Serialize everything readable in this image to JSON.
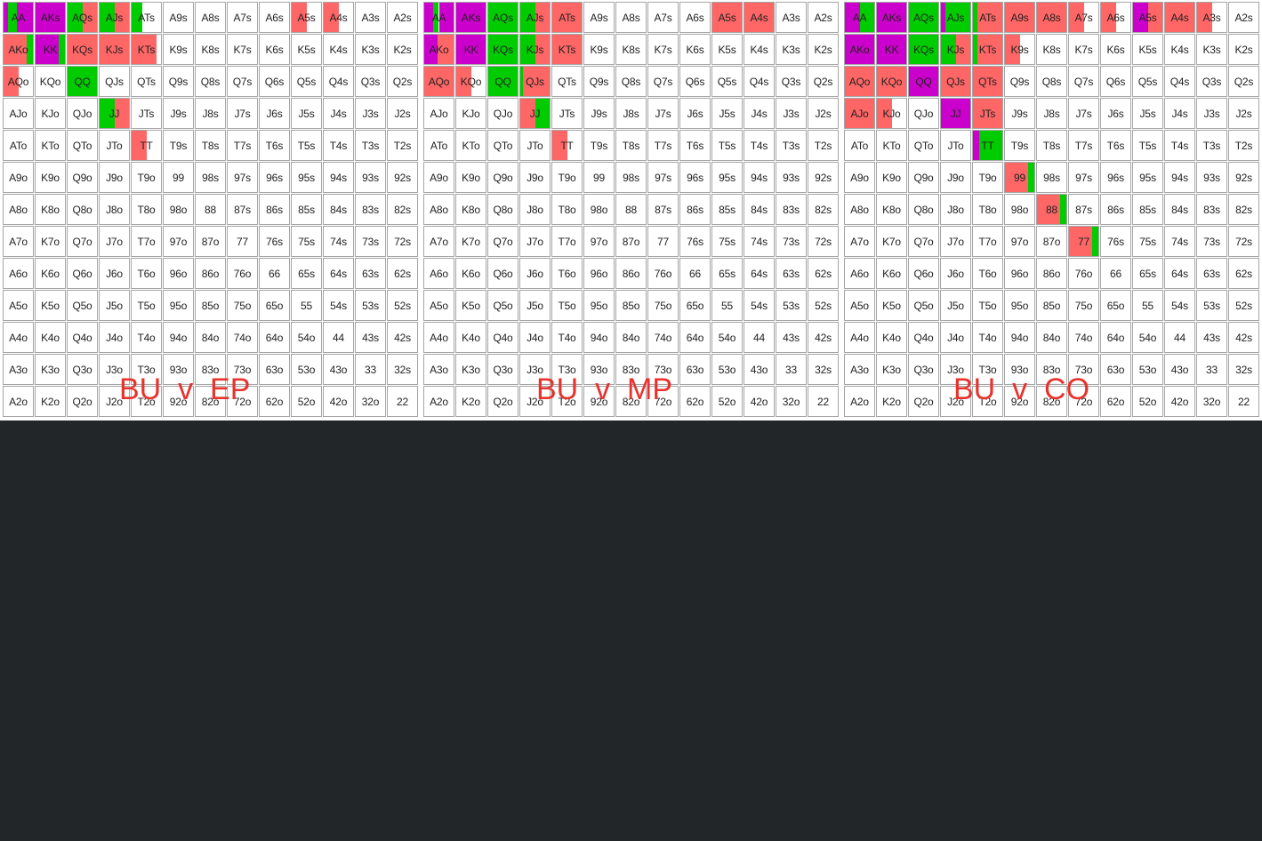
{
  "colors": {
    "raise": "#cc00cc",
    "call": "#00cc00",
    "threebet": "#ff6666",
    "empty": "#ffffff",
    "background": "#232629",
    "title": "#e8322d"
  },
  "ranks": [
    "A",
    "K",
    "Q",
    "J",
    "T",
    "9",
    "8",
    "7",
    "6",
    "5",
    "4",
    "3",
    "2"
  ],
  "charts": [
    {
      "title": "BU  v  EP",
      "segments": {
        "AA": [
          [
            "raise",
            0.15
          ],
          [
            "call",
            0.3
          ],
          [
            "raise",
            0.55
          ]
        ],
        "AKs": [
          [
            "raise",
            1.0
          ]
        ],
        "AQs": [
          [
            "call",
            0.5
          ],
          [
            "threebet",
            0.5
          ]
        ],
        "AJs": [
          [
            "call",
            0.5
          ],
          [
            "threebet",
            0.5
          ]
        ],
        "ATs": [
          [
            "call",
            0.35
          ],
          [
            "empty",
            0.65
          ]
        ],
        "A5s": [
          [
            "threebet",
            0.5
          ],
          [
            "empty",
            0.5
          ]
        ],
        "A4s": [
          [
            "threebet",
            0.5
          ],
          [
            "empty",
            0.5
          ]
        ],
        "AKo": [
          [
            "threebet",
            0.8
          ],
          [
            "call",
            0.2
          ]
        ],
        "KK": [
          [
            "raise",
            0.8
          ],
          [
            "call",
            0.2
          ]
        ],
        "KQs": [
          [
            "threebet",
            1.0
          ]
        ],
        "KJs": [
          [
            "threebet",
            1.0
          ]
        ],
        "KTs": [
          [
            "threebet",
            0.85
          ],
          [
            "empty",
            0.15
          ]
        ],
        "AQo": [
          [
            "threebet",
            0.5
          ],
          [
            "empty",
            0.5
          ]
        ],
        "QQ": [
          [
            "call",
            1.0
          ]
        ],
        "JJ": [
          [
            "call",
            0.5
          ],
          [
            "threebet",
            0.5
          ]
        ],
        "TT": [
          [
            "threebet",
            0.5
          ],
          [
            "empty",
            0.5
          ]
        ]
      }
    },
    {
      "title": "BU  v  MP",
      "segments": {
        "AA": [
          [
            "raise",
            0.3
          ],
          [
            "call",
            0.2
          ],
          [
            "raise",
            0.5
          ]
        ],
        "AKs": [
          [
            "raise",
            1.0
          ]
        ],
        "AQs": [
          [
            "call",
            1.0
          ]
        ],
        "AJs": [
          [
            "call",
            0.5
          ],
          [
            "threebet",
            0.5
          ]
        ],
        "ATs": [
          [
            "threebet",
            1.0
          ]
        ],
        "A5s": [
          [
            "threebet",
            1.0
          ]
        ],
        "A4s": [
          [
            "threebet",
            1.0
          ]
        ],
        "AKo": [
          [
            "raise",
            0.45
          ],
          [
            "threebet",
            0.55
          ]
        ],
        "KK": [
          [
            "raise",
            1.0
          ]
        ],
        "KQs": [
          [
            "call",
            1.0
          ]
        ],
        "KJs": [
          [
            "call",
            0.5
          ],
          [
            "threebet",
            0.5
          ]
        ],
        "KTs": [
          [
            "threebet",
            1.0
          ]
        ],
        "AQo": [
          [
            "threebet",
            1.0
          ]
        ],
        "KQo": [
          [
            "threebet",
            0.5
          ],
          [
            "empty",
            0.5
          ]
        ],
        "QQ": [
          [
            "call",
            1.0
          ]
        ],
        "QJs": [
          [
            "call",
            0.1
          ],
          [
            "threebet",
            0.9
          ]
        ],
        "JJ": [
          [
            "threebet",
            0.5
          ],
          [
            "call",
            0.5
          ]
        ],
        "TT": [
          [
            "threebet",
            0.5
          ],
          [
            "empty",
            0.5
          ]
        ]
      }
    },
    {
      "title": "BU  v  CO",
      "segments": {
        "AA": [
          [
            "raise",
            0.5
          ],
          [
            "call",
            0.5
          ]
        ],
        "AKs": [
          [
            "raise",
            1.0
          ]
        ],
        "AQs": [
          [
            "call",
            1.0
          ]
        ],
        "AJs": [
          [
            "raise",
            0.15
          ],
          [
            "call",
            0.85
          ]
        ],
        "ATs": [
          [
            "call",
            0.15
          ],
          [
            "threebet",
            0.85
          ]
        ],
        "A9s": [
          [
            "threebet",
            1.0
          ]
        ],
        "A8s": [
          [
            "threebet",
            1.0
          ]
        ],
        "A7s": [
          [
            "threebet",
            0.5
          ],
          [
            "empty",
            0.5
          ]
        ],
        "A6s": [
          [
            "threebet",
            0.5
          ],
          [
            "empty",
            0.5
          ]
        ],
        "A5s": [
          [
            "raise",
            0.5
          ],
          [
            "threebet",
            0.5
          ]
        ],
        "A4s": [
          [
            "threebet",
            1.0
          ]
        ],
        "A3s": [
          [
            "threebet",
            0.5
          ],
          [
            "empty",
            0.5
          ]
        ],
        "AKo": [
          [
            "raise",
            1.0
          ]
        ],
        "KK": [
          [
            "raise",
            1.0
          ]
        ],
        "KQs": [
          [
            "call",
            1.0
          ]
        ],
        "KJs": [
          [
            "call",
            0.5
          ],
          [
            "threebet",
            0.5
          ]
        ],
        "KTs": [
          [
            "call",
            0.15
          ],
          [
            "threebet",
            0.85
          ]
        ],
        "K9s": [
          [
            "threebet",
            0.5
          ],
          [
            "empty",
            0.5
          ]
        ],
        "AQo": [
          [
            "threebet",
            1.0
          ]
        ],
        "KQo": [
          [
            "threebet",
            1.0
          ]
        ],
        "QQ": [
          [
            "raise",
            1.0
          ]
        ],
        "QJs": [
          [
            "threebet",
            1.0
          ]
        ],
        "QTs": [
          [
            "threebet",
            1.0
          ]
        ],
        "AJo": [
          [
            "threebet",
            1.0
          ]
        ],
        "KJo": [
          [
            "threebet",
            0.5
          ],
          [
            "empty",
            0.5
          ]
        ],
        "JJ": [
          [
            "raise",
            1.0
          ]
        ],
        "JTs": [
          [
            "threebet",
            1.0
          ]
        ],
        "TT": [
          [
            "raise",
            0.2
          ],
          [
            "call",
            0.8
          ]
        ],
        "99": [
          [
            "threebet",
            0.8
          ],
          [
            "call",
            0.2
          ]
        ],
        "88": [
          [
            "threebet",
            0.8
          ],
          [
            "call",
            0.2
          ]
        ],
        "77": [
          [
            "threebet",
            0.8
          ],
          [
            "call",
            0.2
          ]
        ]
      }
    }
  ]
}
